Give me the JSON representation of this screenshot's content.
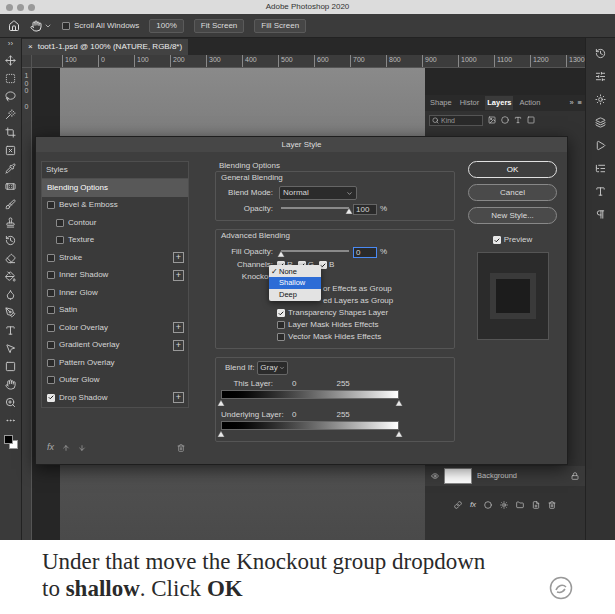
{
  "app": {
    "title": "Adobe Photoshop 2020"
  },
  "options_bar": {
    "scroll_all_windows": {
      "label": "Scroll All Windows",
      "checked": false
    },
    "buttons": [
      "100%",
      "Fit Screen",
      "Fill Screen"
    ]
  },
  "toolbar": {
    "collapse": "››"
  },
  "document_tab": {
    "close": "×",
    "title": "toot1-1.psd @ 100% (NATURE, RGB/8*)",
    "selected": true
  },
  "ruler": {
    "horizontal": [
      "100",
      "0",
      "100",
      "200",
      "300",
      "400",
      "500",
      "600",
      "700",
      "800",
      "900",
      "1000",
      "1100",
      "1200",
      "1300"
    ],
    "vertical": [
      "100",
      "0"
    ]
  },
  "panel": {
    "tabs": [
      {
        "label": "Shape",
        "selected": false
      },
      {
        "label": "Histor",
        "selected": false
      },
      {
        "label": "Layers",
        "selected": true
      },
      {
        "label": "Action",
        "selected": false
      }
    ],
    "more": "»",
    "menu": "≡",
    "search": {
      "placeholder": "Kind"
    },
    "layers": [
      {
        "name": "Background",
        "visible": true,
        "locked": true
      }
    ],
    "footer": {
      "fx": "fx"
    }
  },
  "dialog": {
    "title": "Layer Style",
    "styles_header": "Styles",
    "add_symbol": "+",
    "styles": [
      {
        "label": "Blending Options",
        "kind": "header",
        "selected": true,
        "checked": false,
        "has_add": false
      },
      {
        "label": "Bevel & Emboss",
        "kind": "effect",
        "selected": false,
        "checked": false,
        "has_add": false
      },
      {
        "label": "Contour",
        "kind": "sub",
        "selected": false,
        "checked": false,
        "has_add": false
      },
      {
        "label": "Texture",
        "kind": "sub",
        "selected": false,
        "checked": false,
        "has_add": false
      },
      {
        "label": "Stroke",
        "kind": "effect",
        "selected": false,
        "checked": false,
        "has_add": true
      },
      {
        "label": "Inner Shadow",
        "kind": "effect",
        "selected": false,
        "checked": false,
        "has_add": true
      },
      {
        "label": "Inner Glow",
        "kind": "effect",
        "selected": false,
        "checked": false,
        "has_add": false
      },
      {
        "label": "Satin",
        "kind": "effect",
        "selected": false,
        "checked": false,
        "has_add": false
      },
      {
        "label": "Color Overlay",
        "kind": "effect",
        "selected": false,
        "checked": false,
        "has_add": true
      },
      {
        "label": "Gradient Overlay",
        "kind": "effect",
        "selected": false,
        "checked": false,
        "has_add": true
      },
      {
        "label": "Pattern Overlay",
        "kind": "effect",
        "selected": false,
        "checked": false,
        "has_add": false
      },
      {
        "label": "Outer Glow",
        "kind": "effect",
        "selected": false,
        "checked": false,
        "has_add": false
      },
      {
        "label": "Drop Shadow",
        "kind": "effect",
        "selected": false,
        "checked": true,
        "has_add": true
      }
    ],
    "footer": {
      "fx": "fx"
    },
    "blending": {
      "title": "Blending Options",
      "general": {
        "title": "General Blending",
        "blend_mode": {
          "label": "Blend Mode:",
          "value": "Normal"
        },
        "opacity": {
          "label": "Opacity:",
          "value": "100",
          "unit": "%",
          "level": 1
        }
      },
      "advanced": {
        "title": "Advanced Blending",
        "fill_opacity": {
          "label": "Fill Opacity:",
          "value": "0",
          "unit": "%",
          "level": 0,
          "focused": true
        },
        "channels": {
          "label": "Channels:",
          "items": [
            {
              "label": "R",
              "checked": true
            },
            {
              "label": "G",
              "checked": true
            },
            {
              "label": "B",
              "checked": true
            }
          ]
        },
        "knockout": {
          "label": "Knockou",
          "menu": {
            "check": "✓",
            "options": [
              {
                "label": "None",
                "checked": true,
                "selected": false
              },
              {
                "label": "Shallow",
                "checked": false,
                "selected": true
              },
              {
                "label": "Deep",
                "checked": false,
                "selected": false
              }
            ]
          }
        },
        "options": [
          {
            "label": "or Effects as Group",
            "kind": "covered",
            "checked": false
          },
          {
            "label": "ed Layers as Group",
            "kind": "covered",
            "checked": false
          },
          {
            "label": "Transparency Shapes Layer",
            "kind": "checkbox",
            "checked": true
          },
          {
            "label": "Layer Mask Hides Effects",
            "kind": "checkbox",
            "checked": false
          },
          {
            "label": "Vector Mask Hides Effects",
            "kind": "checkbox",
            "checked": false
          }
        ]
      },
      "blend_if": {
        "label": "Blend If:",
        "value": "Gray",
        "ranges": [
          {
            "label": "This Layer:",
            "low": "0",
            "high": "255",
            "low_level": 0,
            "high_level": 1
          },
          {
            "label": "Underlying Layer:",
            "low": "0",
            "high": "255",
            "low_level": 0,
            "high_level": 1
          }
        ]
      }
    },
    "buttons": [
      {
        "label": "OK",
        "default": true
      },
      {
        "label": "Cancel",
        "default": false
      },
      {
        "label": "New Style...",
        "default": false
      }
    ],
    "preview": {
      "label": "Preview",
      "checked": true
    }
  },
  "caption": {
    "lines": [
      [
        {
          "text": "Under that move the Knockout group dropdown",
          "bold": false
        }
      ],
      [
        {
          "text": "to ",
          "bold": false
        },
        {
          "text": "shallow",
          "bold": true
        },
        {
          "text": ". Click ",
          "bold": false
        },
        {
          "text": "OK",
          "bold": true
        }
      ]
    ]
  }
}
